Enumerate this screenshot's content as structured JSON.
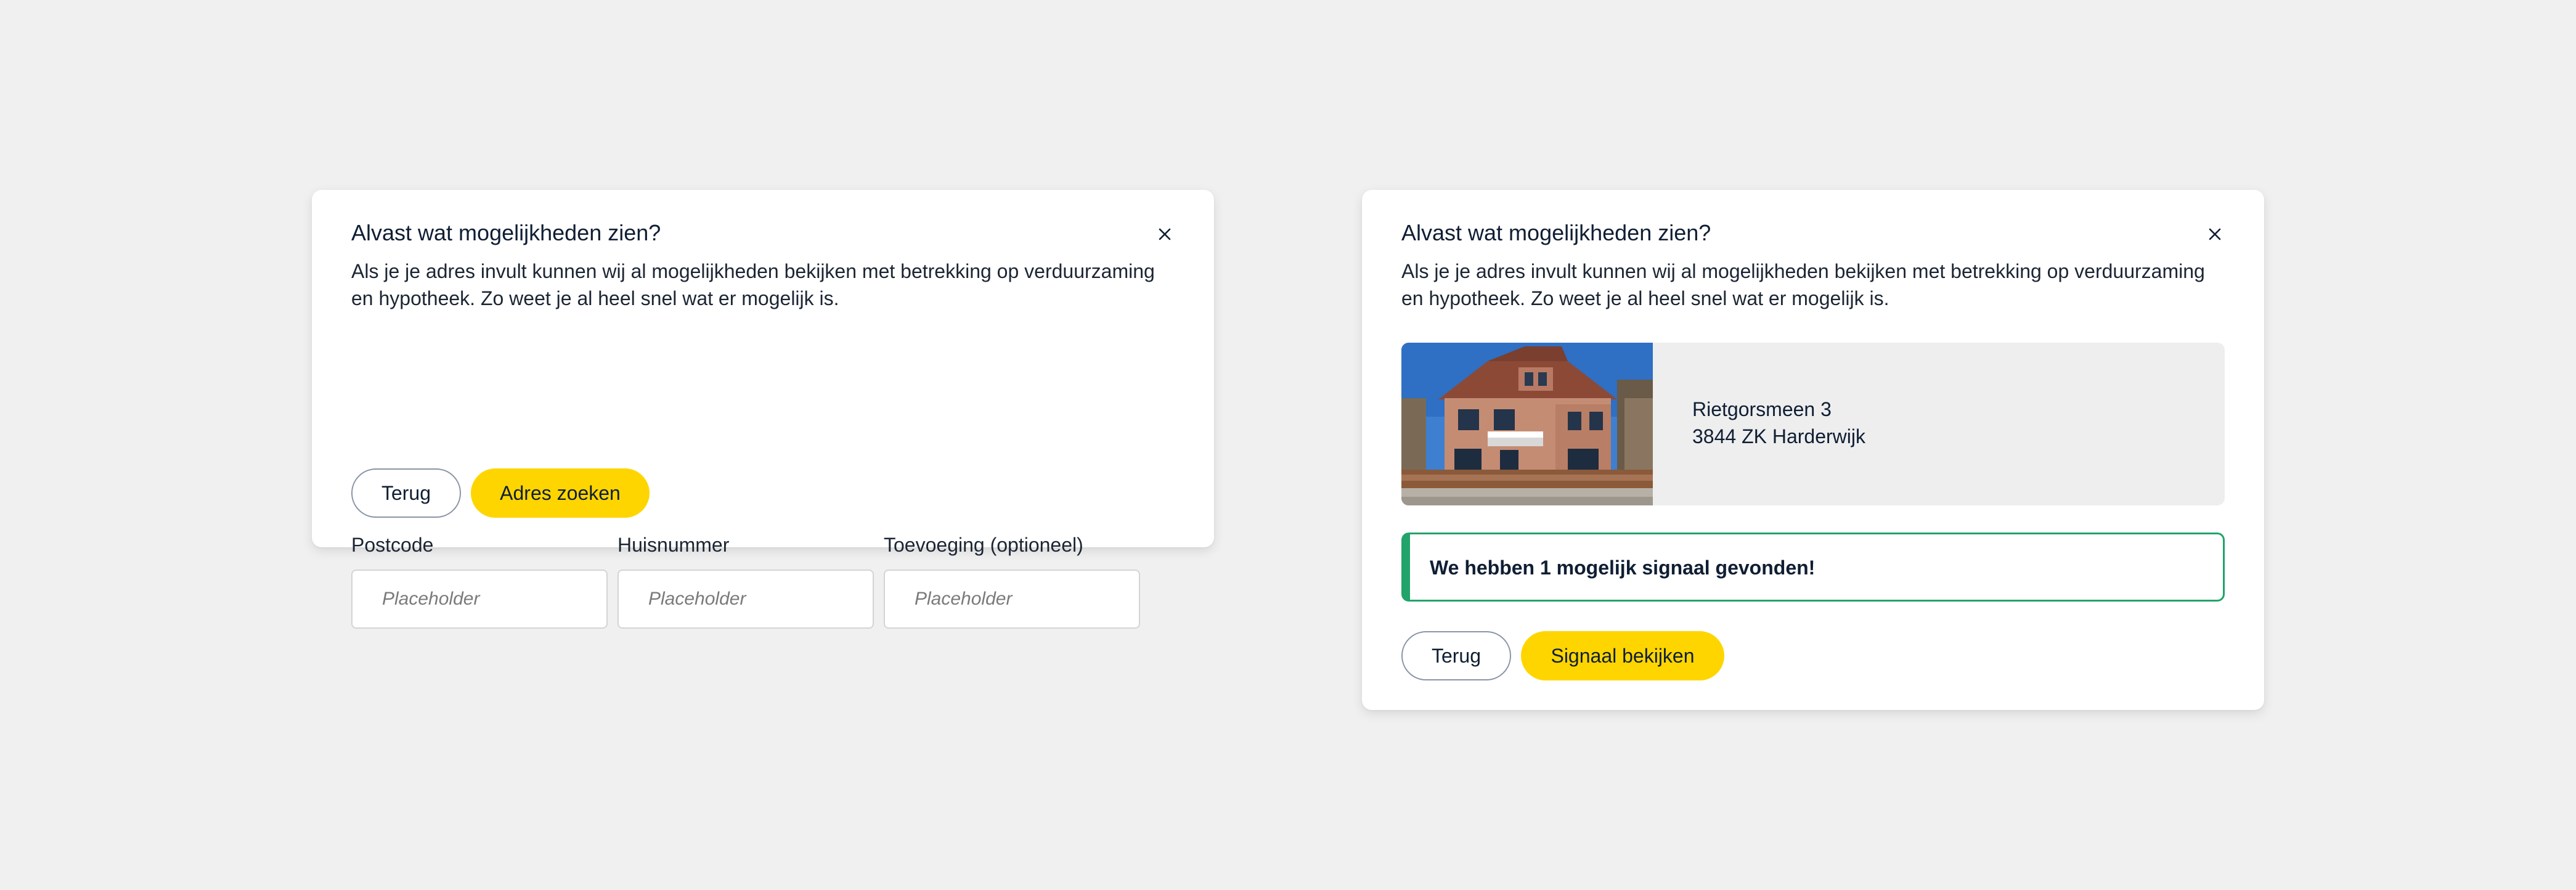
{
  "left_modal": {
    "title": "Alvast wat mogelijkheden zien?",
    "description": "Als je je adres invult kunnen wij al mogelijkheden bekijken met betrekking op verduurzaming en hypotheek. Zo weet je al heel snel wat er mogelijk is.",
    "fields": [
      {
        "label": "Postcode",
        "placeholder": "Placeholder",
        "value": ""
      },
      {
        "label": "Huisnummer",
        "placeholder": "Placeholder",
        "value": ""
      },
      {
        "label": "Toevoeging (optioneel)",
        "placeholder": "Placeholder",
        "value": ""
      }
    ],
    "back_label": "Terug",
    "submit_label": "Adres zoeken",
    "close_icon": "close-icon"
  },
  "right_modal": {
    "title": "Alvast wat mogelijkheden zien?",
    "description": "Als je je adres invult kunnen wij al mogelijkheden bekijken met betrekking op verduurzaming en hypotheek. Zo weet je al heel snel wat er mogelijk is.",
    "address": {
      "street": "Rietgorsmeen 3",
      "postal_city": "3844 ZK Harderwijk"
    },
    "alert": "We hebben 1 mogelijk signaal gevonden!",
    "back_label": "Terug",
    "submit_label": "Signaal bekijken",
    "close_icon": "close-icon"
  },
  "colors": {
    "background": "#f0f0f0",
    "primary_button": "#ffd500",
    "text": "#0f1e33",
    "success": "#22a36a",
    "input_border": "#d4d4d4"
  }
}
